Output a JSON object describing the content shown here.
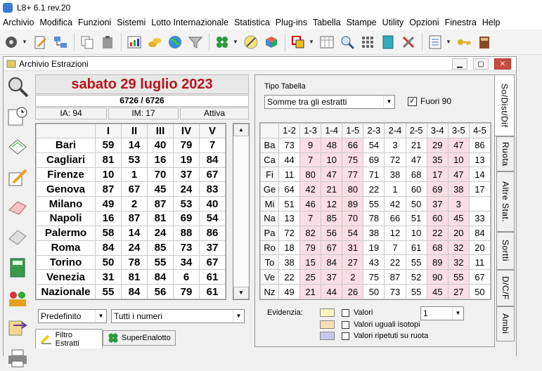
{
  "window": {
    "title": "L8+ 6.1 rev.20"
  },
  "menu": [
    "Archivio",
    "Modifica",
    "Funzioni",
    "Sistemi",
    "Lotto Internazionale",
    "Statistica",
    "Plug-ins",
    "Tabella",
    "Stampe",
    "Utility",
    "Opzioni",
    "Finestra",
    "Help"
  ],
  "child": {
    "title": "Archivio Estrazioni"
  },
  "draw": {
    "date": "sabato 29 luglio 2023",
    "count": "6726 / 6726",
    "ia": "IA: 94",
    "im": "IM: 17",
    "status": "Attiva"
  },
  "main_table": {
    "headers": [
      "I",
      "II",
      "III",
      "IV",
      "V"
    ],
    "rows": [
      {
        "city": "Bari",
        "n": [
          "59",
          "14",
          "40",
          "79",
          "7"
        ]
      },
      {
        "city": "Cagliari",
        "n": [
          "81",
          "53",
          "16",
          "19",
          "84"
        ]
      },
      {
        "city": "Firenze",
        "n": [
          "10",
          "1",
          "70",
          "37",
          "67"
        ]
      },
      {
        "city": "Genova",
        "n": [
          "87",
          "67",
          "45",
          "24",
          "83"
        ]
      },
      {
        "city": "Milano",
        "n": [
          "49",
          "2",
          "87",
          "53",
          "40"
        ]
      },
      {
        "city": "Napoli",
        "n": [
          "16",
          "87",
          "81",
          "69",
          "54"
        ]
      },
      {
        "city": "Palermo",
        "n": [
          "58",
          "14",
          "24",
          "88",
          "86"
        ]
      },
      {
        "city": "Roma",
        "n": [
          "84",
          "24",
          "85",
          "73",
          "37"
        ]
      },
      {
        "city": "Torino",
        "n": [
          "50",
          "78",
          "55",
          "34",
          "67"
        ]
      },
      {
        "city": "Venezia",
        "n": [
          "31",
          "81",
          "84",
          "6",
          "61"
        ]
      },
      {
        "city": "Nazionale",
        "n": [
          "55",
          "84",
          "56",
          "79",
          "61"
        ]
      }
    ]
  },
  "filters": {
    "combo1": "Predefinito",
    "combo2": "Tutti i numeri"
  },
  "bottom_tabs": [
    "Filtro Estratti",
    "SuperEnalotto"
  ],
  "right": {
    "tipo_label": "Tipo Tabella",
    "tipo_value": "Somme tra gli estratti",
    "fuori_label": "Fuori 90",
    "fuori_checked": "✓",
    "headers": [
      "1-2",
      "1-3",
      "1-4",
      "1-5",
      "2-3",
      "2-4",
      "2-5",
      "3-4",
      "3-5",
      "4-5"
    ],
    "rows": [
      {
        "r": "Ba",
        "v": [
          "73",
          "9",
          "48",
          "66",
          "54",
          "3",
          "21",
          "29",
          "47",
          "86"
        ]
      },
      {
        "r": "Ca",
        "v": [
          "44",
          "7",
          "10",
          "75",
          "69",
          "72",
          "47",
          "35",
          "10",
          "13"
        ]
      },
      {
        "r": "Fi",
        "v": [
          "11",
          "80",
          "47",
          "77",
          "71",
          "38",
          "68",
          "17",
          "47",
          "14"
        ]
      },
      {
        "r": "Ge",
        "v": [
          "64",
          "42",
          "21",
          "80",
          "22",
          "1",
          "60",
          "69",
          "38",
          "17"
        ]
      },
      {
        "r": "Mi",
        "v": [
          "51",
          "46",
          "12",
          "89",
          "55",
          "42",
          "50",
          "37",
          "3",
          ""
        ]
      },
      {
        "r": "Na",
        "v": [
          "13",
          "7",
          "85",
          "70",
          "78",
          "66",
          "51",
          "60",
          "45",
          "33"
        ]
      },
      {
        "r": "Pa",
        "v": [
          "72",
          "82",
          "56",
          "54",
          "38",
          "12",
          "10",
          "22",
          "20",
          "84"
        ]
      },
      {
        "r": "Ro",
        "v": [
          "18",
          "79",
          "67",
          "31",
          "19",
          "7",
          "61",
          "68",
          "32",
          "20"
        ]
      },
      {
        "r": "To",
        "v": [
          "38",
          "15",
          "84",
          "27",
          "43",
          "22",
          "55",
          "89",
          "32",
          "11"
        ]
      },
      {
        "r": "Ve",
        "v": [
          "22",
          "25",
          "37",
          "2",
          "75",
          "87",
          "52",
          "90",
          "55",
          "67"
        ]
      },
      {
        "r": "Nz",
        "v": [
          "49",
          "21",
          "44",
          "26",
          "50",
          "73",
          "55",
          "45",
          "27",
          "50"
        ]
      }
    ],
    "evidenzia_label": "Evidenzia:",
    "legend": [
      "Valori",
      "Valori uguali isotopi",
      "Valori ripetuti su ruota"
    ],
    "valori_select": "1"
  },
  "colors": {
    "date_red": "#b8141a",
    "pink": "#fbdde6",
    "sw1": "#fbf4b9",
    "sw2": "#f6ddb8",
    "sw3": "#c9c6ee"
  },
  "side_tabs": [
    "So/Dist/Dif",
    "Ruota",
    "Altre Stat.",
    "Sortti",
    "D/C/F",
    "Ambi"
  ]
}
